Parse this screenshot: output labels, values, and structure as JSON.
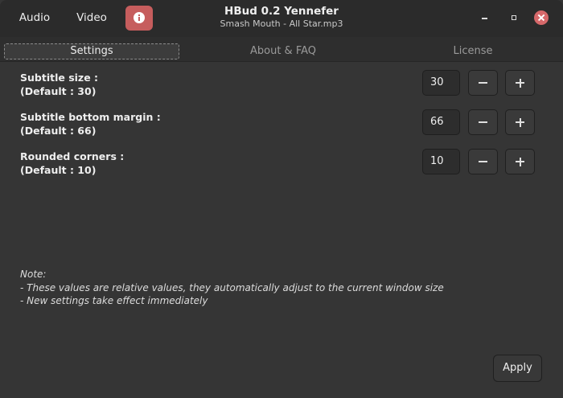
{
  "header": {
    "buttons": {
      "audio": "Audio",
      "video": "Video"
    },
    "info_icon": "info-icon",
    "title": "HBud 0.2 Yennefer",
    "subtitle": "Smash Mouth - All Star.mp3",
    "window_controls": [
      "minimize",
      "maximize",
      "close"
    ]
  },
  "tabs": [
    {
      "label": "Settings",
      "active": true
    },
    {
      "label": "About & FAQ",
      "active": false
    },
    {
      "label": "License",
      "active": false
    }
  ],
  "settings": [
    {
      "label": "Subtitle size :",
      "default": "(Default : 30)",
      "value": "30"
    },
    {
      "label": "Subtitle bottom margin :",
      "default": "(Default : 66)",
      "value": "66"
    },
    {
      "label": "Rounded corners :",
      "default": "(Default : 10)",
      "value": "10"
    }
  ],
  "note": {
    "title": "Note:",
    "lines": [
      "- These values are relative values, they automatically adjust to the current window size",
      "- New settings take effect immediately"
    ]
  },
  "apply_label": "Apply",
  "colors": {
    "accent": "#c65d5d",
    "close": "#d6686a",
    "background": "#353535",
    "headerbar": "#2b2b2b"
  }
}
